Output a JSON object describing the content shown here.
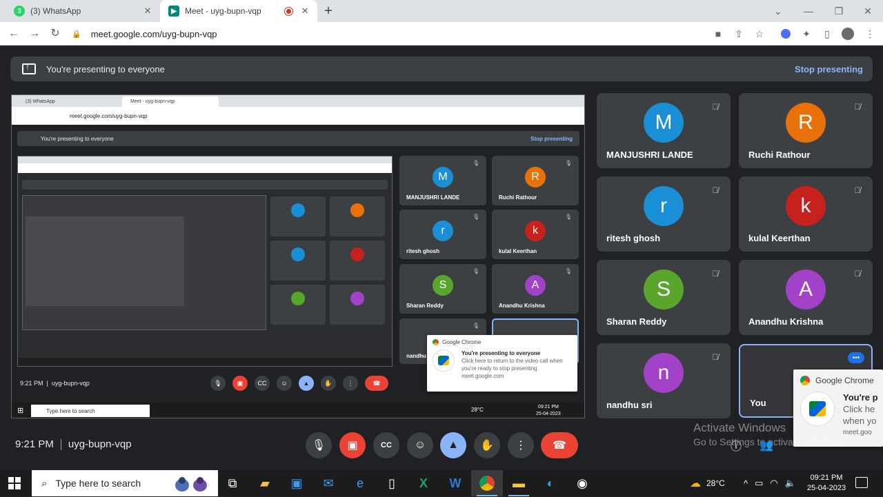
{
  "browser": {
    "tabs": [
      {
        "label": "(3) WhatsApp",
        "favicon": "whatsapp-icon"
      },
      {
        "label": "Meet - uyg-bupn-vqp",
        "favicon": "meet-icon",
        "recording": true
      }
    ],
    "url": "meet.google.com/uyg-bupn-vqp"
  },
  "banner": {
    "text": "You're presenting to everyone",
    "stop": "Stop presenting"
  },
  "shared_screen": {
    "tabs": [
      "(3) WhatsApp",
      "Meet - uyg-bupn-vqp"
    ],
    "url": "meet.google.com/uyg-bupn-vqp",
    "banner_text": "You're presenting to everyone",
    "banner_stop": "Stop presenting",
    "tiles": [
      {
        "initial": "M",
        "name": "MANJUSHRI LANDE",
        "color": "#1a8fd6"
      },
      {
        "initial": "R",
        "name": "Ruchi Rathour",
        "color": "#e8710a"
      },
      {
        "initial": "r",
        "name": "ritesh ghosh",
        "color": "#1a8fd6"
      },
      {
        "initial": "k",
        "name": "kulal Keerthan",
        "color": "#c5221f"
      },
      {
        "initial": "S",
        "name": "Sharan Reddy",
        "color": "#5aa62c"
      },
      {
        "initial": "A",
        "name": "Anandhu Krishna",
        "color": "#a142c9"
      },
      {
        "initial": "",
        "name": "nandhu",
        "color": "#a142c9"
      }
    ],
    "time": "9:21 PM",
    "code": "uyg-bupn-vqp",
    "taskbar_search": "Type here to search",
    "temp": "28°C",
    "clock_time": "09:21 PM",
    "clock_date": "25-04-2023",
    "toast": {
      "app": "Google Chrome",
      "title": "You're presenting to everyone",
      "body": "Click here to return to the video call when you're ready to stop presenting",
      "source": "meet.google.com",
      "watermark": "Activate Windows",
      "watermark2": "Go to Settings to activate Windows."
    }
  },
  "participants": [
    {
      "initial": "M",
      "name": "MANJUSHRI LANDE",
      "color": "#1a8fd6"
    },
    {
      "initial": "R",
      "name": "Ruchi Rathour",
      "color": "#e8710a"
    },
    {
      "initial": "r",
      "name": "ritesh ghosh",
      "color": "#1a8fd6"
    },
    {
      "initial": "k",
      "name": "kulal Keerthan",
      "color": "#c5221f"
    },
    {
      "initial": "S",
      "name": "Sharan Reddy",
      "color": "#5aa62c"
    },
    {
      "initial": "A",
      "name": "Anandhu Krishna",
      "color": "#a142c9"
    },
    {
      "initial": "n",
      "name": "nandhu sri",
      "color": "#a142c9"
    },
    {
      "initial": "",
      "name": "You",
      "color": "#35363a"
    }
  ],
  "meeting": {
    "time": "9:21 PM",
    "code": "uyg-bupn-vqp"
  },
  "toast": {
    "app": "Google Chrome",
    "title": "You're p",
    "line1": "Click he",
    "line2": "when yo",
    "source": "meet.goo"
  },
  "watermark": {
    "line1": "Activate Windows",
    "line2": "Go to Settings to activate Windows."
  },
  "taskbar": {
    "search_placeholder": "Type here to search",
    "weather": "28°C",
    "time": "09:21 PM",
    "date": "25-04-2023"
  },
  "colors": {
    "meet_bg": "#202124",
    "tile_bg": "#3c4043",
    "accent_blue": "#8ab4f8",
    "hangup_red": "#ea4335"
  }
}
